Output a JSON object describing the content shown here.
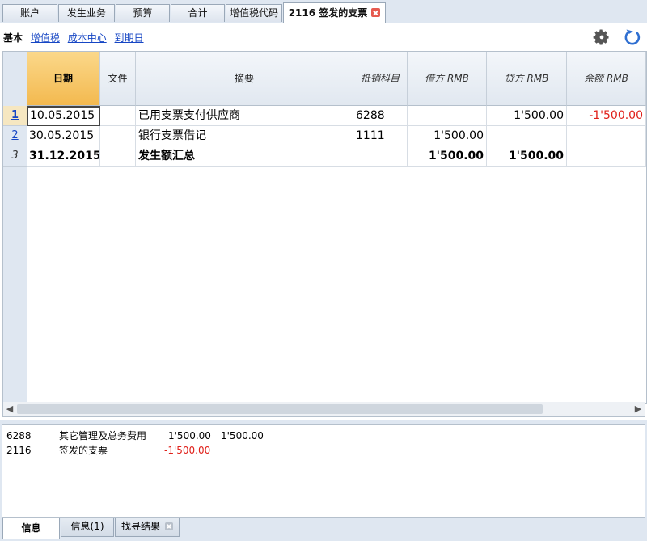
{
  "tabs": [
    {
      "label": "账户"
    },
    {
      "label": "发生业务"
    },
    {
      "label": "预算"
    },
    {
      "label": "合计"
    },
    {
      "label": "增值税代码"
    },
    {
      "label": "2116 签发的支票",
      "active": true
    }
  ],
  "views": {
    "active": "基本",
    "links": [
      "增值税",
      "成本中心",
      "到期日"
    ]
  },
  "icons": {
    "settings": "gear-icon",
    "refresh": "refresh-icon",
    "close": "close-icon"
  },
  "colors": {
    "selected_header": "#f3b94f",
    "negative": "#e0201a",
    "link": "#1646c4"
  },
  "table": {
    "headers": [
      "日期",
      "文件",
      "摘要",
      "抵销科目",
      "借方 RMB",
      "贷方 RMB",
      "余额 RMB"
    ],
    "rows": [
      {
        "num": "1",
        "date": "10.05.2015",
        "doc": "",
        "desc": "已用支票支付供应商",
        "contra": "6288",
        "debit": "",
        "credit": "1'500.00",
        "balance": "-1'500.00"
      },
      {
        "num": "2",
        "date": "30.05.2015",
        "doc": "",
        "desc": "银行支票借记",
        "contra": "1111",
        "debit": "1'500.00",
        "credit": "",
        "balance": ""
      },
      {
        "num": "3",
        "date": "31.12.2015",
        "doc": "",
        "desc": "发生额汇总",
        "contra": "",
        "debit": "1'500.00",
        "credit": "1'500.00",
        "balance": ""
      }
    ]
  },
  "info_panel": {
    "rows": [
      {
        "account": "6288",
        "name": "其它管理及总务费用",
        "debit": "1'500.00",
        "credit": "1'500.00"
      },
      {
        "account": "2116",
        "name": "签发的支票",
        "debit": "-1'500.00",
        "credit": ""
      }
    ]
  },
  "bottom_tabs": [
    {
      "label": "信息",
      "active": true
    },
    {
      "label": "信息(1)"
    },
    {
      "label": "找寻结果"
    }
  ]
}
